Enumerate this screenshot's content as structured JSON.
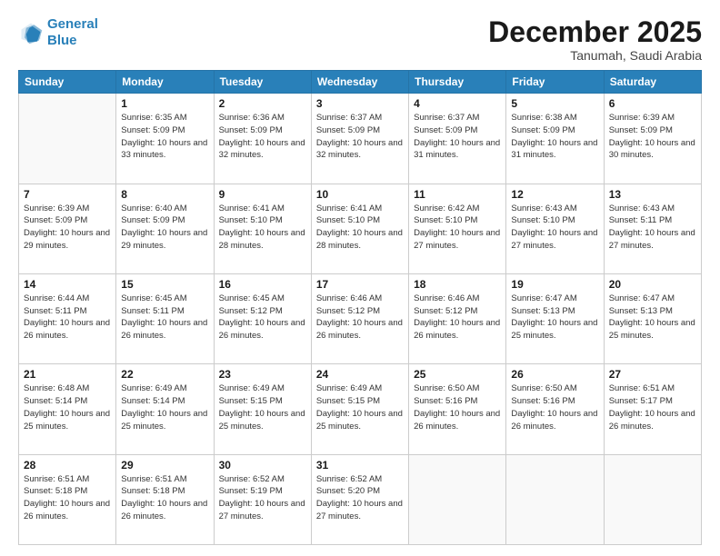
{
  "header": {
    "logo_line1": "General",
    "logo_line2": "Blue",
    "month_title": "December 2025",
    "subtitle": "Tanumah, Saudi Arabia"
  },
  "weekdays": [
    "Sunday",
    "Monday",
    "Tuesday",
    "Wednesday",
    "Thursday",
    "Friday",
    "Saturday"
  ],
  "weeks": [
    [
      {
        "day": "",
        "info": ""
      },
      {
        "day": "1",
        "info": "Sunrise: 6:35 AM\nSunset: 5:09 PM\nDaylight: 10 hours\nand 33 minutes."
      },
      {
        "day": "2",
        "info": "Sunrise: 6:36 AM\nSunset: 5:09 PM\nDaylight: 10 hours\nand 32 minutes."
      },
      {
        "day": "3",
        "info": "Sunrise: 6:37 AM\nSunset: 5:09 PM\nDaylight: 10 hours\nand 32 minutes."
      },
      {
        "day": "4",
        "info": "Sunrise: 6:37 AM\nSunset: 5:09 PM\nDaylight: 10 hours\nand 31 minutes."
      },
      {
        "day": "5",
        "info": "Sunrise: 6:38 AM\nSunset: 5:09 PM\nDaylight: 10 hours\nand 31 minutes."
      },
      {
        "day": "6",
        "info": "Sunrise: 6:39 AM\nSunset: 5:09 PM\nDaylight: 10 hours\nand 30 minutes."
      }
    ],
    [
      {
        "day": "7",
        "info": "Sunrise: 6:39 AM\nSunset: 5:09 PM\nDaylight: 10 hours\nand 29 minutes."
      },
      {
        "day": "8",
        "info": "Sunrise: 6:40 AM\nSunset: 5:09 PM\nDaylight: 10 hours\nand 29 minutes."
      },
      {
        "day": "9",
        "info": "Sunrise: 6:41 AM\nSunset: 5:10 PM\nDaylight: 10 hours\nand 28 minutes."
      },
      {
        "day": "10",
        "info": "Sunrise: 6:41 AM\nSunset: 5:10 PM\nDaylight: 10 hours\nand 28 minutes."
      },
      {
        "day": "11",
        "info": "Sunrise: 6:42 AM\nSunset: 5:10 PM\nDaylight: 10 hours\nand 27 minutes."
      },
      {
        "day": "12",
        "info": "Sunrise: 6:43 AM\nSunset: 5:10 PM\nDaylight: 10 hours\nand 27 minutes."
      },
      {
        "day": "13",
        "info": "Sunrise: 6:43 AM\nSunset: 5:11 PM\nDaylight: 10 hours\nand 27 minutes."
      }
    ],
    [
      {
        "day": "14",
        "info": "Sunrise: 6:44 AM\nSunset: 5:11 PM\nDaylight: 10 hours\nand 26 minutes."
      },
      {
        "day": "15",
        "info": "Sunrise: 6:45 AM\nSunset: 5:11 PM\nDaylight: 10 hours\nand 26 minutes."
      },
      {
        "day": "16",
        "info": "Sunrise: 6:45 AM\nSunset: 5:12 PM\nDaylight: 10 hours\nand 26 minutes."
      },
      {
        "day": "17",
        "info": "Sunrise: 6:46 AM\nSunset: 5:12 PM\nDaylight: 10 hours\nand 26 minutes."
      },
      {
        "day": "18",
        "info": "Sunrise: 6:46 AM\nSunset: 5:12 PM\nDaylight: 10 hours\nand 26 minutes."
      },
      {
        "day": "19",
        "info": "Sunrise: 6:47 AM\nSunset: 5:13 PM\nDaylight: 10 hours\nand 25 minutes."
      },
      {
        "day": "20",
        "info": "Sunrise: 6:47 AM\nSunset: 5:13 PM\nDaylight: 10 hours\nand 25 minutes."
      }
    ],
    [
      {
        "day": "21",
        "info": "Sunrise: 6:48 AM\nSunset: 5:14 PM\nDaylight: 10 hours\nand 25 minutes."
      },
      {
        "day": "22",
        "info": "Sunrise: 6:49 AM\nSunset: 5:14 PM\nDaylight: 10 hours\nand 25 minutes."
      },
      {
        "day": "23",
        "info": "Sunrise: 6:49 AM\nSunset: 5:15 PM\nDaylight: 10 hours\nand 25 minutes."
      },
      {
        "day": "24",
        "info": "Sunrise: 6:49 AM\nSunset: 5:15 PM\nDaylight: 10 hours\nand 25 minutes."
      },
      {
        "day": "25",
        "info": "Sunrise: 6:50 AM\nSunset: 5:16 PM\nDaylight: 10 hours\nand 26 minutes."
      },
      {
        "day": "26",
        "info": "Sunrise: 6:50 AM\nSunset: 5:16 PM\nDaylight: 10 hours\nand 26 minutes."
      },
      {
        "day": "27",
        "info": "Sunrise: 6:51 AM\nSunset: 5:17 PM\nDaylight: 10 hours\nand 26 minutes."
      }
    ],
    [
      {
        "day": "28",
        "info": "Sunrise: 6:51 AM\nSunset: 5:18 PM\nDaylight: 10 hours\nand 26 minutes."
      },
      {
        "day": "29",
        "info": "Sunrise: 6:51 AM\nSunset: 5:18 PM\nDaylight: 10 hours\nand 26 minutes."
      },
      {
        "day": "30",
        "info": "Sunrise: 6:52 AM\nSunset: 5:19 PM\nDaylight: 10 hours\nand 27 minutes."
      },
      {
        "day": "31",
        "info": "Sunrise: 6:52 AM\nSunset: 5:20 PM\nDaylight: 10 hours\nand 27 minutes."
      },
      {
        "day": "",
        "info": ""
      },
      {
        "day": "",
        "info": ""
      },
      {
        "day": "",
        "info": ""
      }
    ]
  ]
}
